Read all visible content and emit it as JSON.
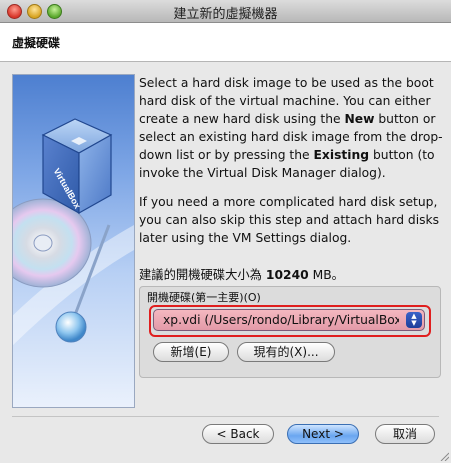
{
  "window": {
    "title": "建立新的虛擬機器"
  },
  "header": {
    "title": "虛擬硬碟"
  },
  "description": {
    "paragraph1_parts": [
      "Select a hard disk image to be used as the boot hard disk of the virtual machine. You can either create a new hard disk using the ",
      "New",
      " button or select an existing hard disk image from the drop-down list or by pressing the ",
      "Existing",
      " button (to invoke the Virtual Disk Manager dialog)."
    ],
    "paragraph2": "If you need a more complicated hard disk setup, you can also skip this step and attach hard disks later using the VM Settings dialog."
  },
  "recommended": {
    "prefix": "建議的開機硬碟大小為",
    "size": "10240",
    "suffix": "MB。"
  },
  "boot_disk": {
    "label": "開機硬碟(第一主要)(O)",
    "selected": "xp.vdi (/Users/rondo/Library/VirtualBox/VDI/xp.vdi)",
    "new_button": "新增(E)",
    "existing_button": "現有的(X)..."
  },
  "nav": {
    "back": "< Back",
    "next": "Next >",
    "cancel": "取消"
  },
  "artwork": {
    "logo_text": "VirtualBox"
  }
}
